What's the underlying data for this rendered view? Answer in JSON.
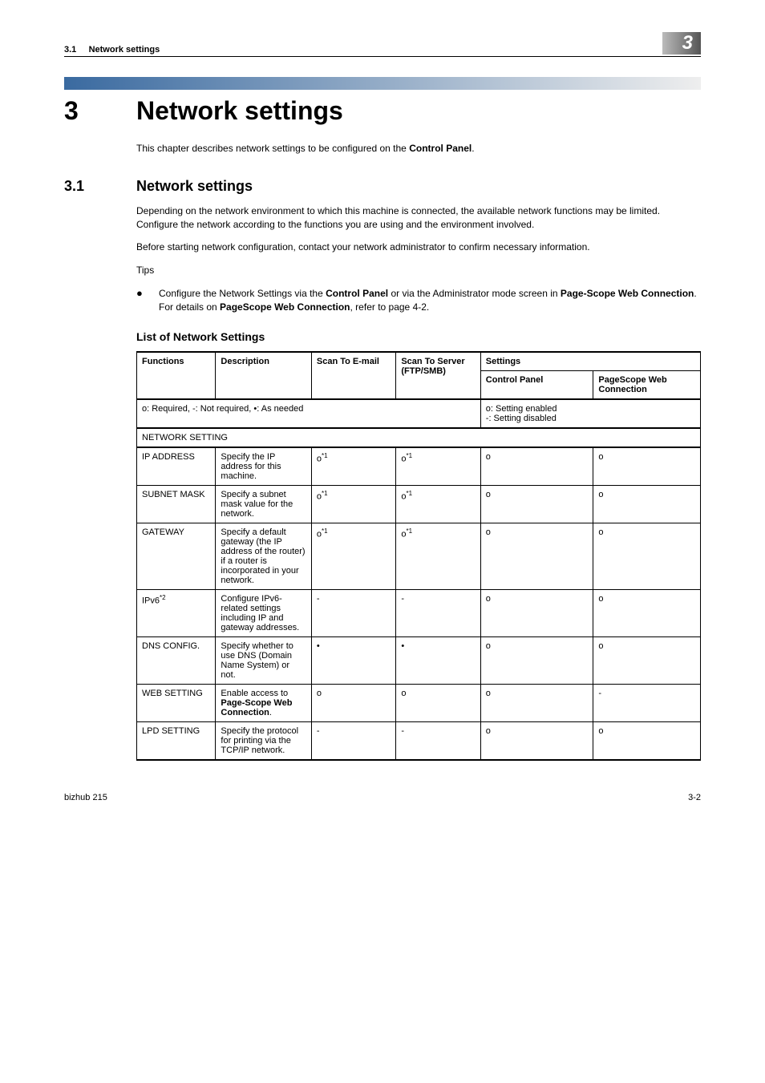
{
  "header": {
    "section_ref": "3.1",
    "section_text": "Network settings",
    "chapter_badge": "3"
  },
  "chapter": {
    "number": "3",
    "title": "Network settings",
    "intro": "This chapter describes network settings to be configured on the ",
    "intro_bold": "Control Panel",
    "intro_suffix": "."
  },
  "section": {
    "number": "3.1",
    "title": "Network settings",
    "p1": "Depending on the network environment to which this machine is connected, the available network functions may be limited. Configure the network according to the functions you are using and the environment involved.",
    "p2": "Before starting network configuration, contact your network administrator to confirm necessary information.",
    "tips_label": "Tips",
    "bullet_pre": "Configure the Network Settings via the ",
    "bullet_b1": "Control Panel",
    "bullet_mid1": " or via the Administrator mode screen in ",
    "bullet_b2": "Page-Scope Web Connection",
    "bullet_mid2": ". For details on ",
    "bullet_b3": "PageScope Web Connection",
    "bullet_suffix": ", refer to page 4-2."
  },
  "table": {
    "heading": "List of Network Settings",
    "cols": {
      "functions": "Functions",
      "description": "Description",
      "scan_email": "Scan To E-mail",
      "scan_server": "Scan To Server (FTP/SMB)",
      "settings": "Settings",
      "control_panel": "Control Panel",
      "pagescope": "PageScope Web Connection"
    },
    "legend_left": "o: Required, -: Not required, •: As needed",
    "legend_right": "o: Setting enabled\n-: Setting disabled",
    "group": "NETWORK SETTING",
    "rows": [
      {
        "fn": "IP ADDRESS",
        "desc": "Specify the IP address for this machine.",
        "email": "o*1",
        "server": "o*1",
        "cp": "o",
        "ps": "o"
      },
      {
        "fn": "SUBNET MASK",
        "desc": "Specify a subnet mask value for the network.",
        "email": "o*1",
        "server": "o*1",
        "cp": "o",
        "ps": "o"
      },
      {
        "fn": "GATEWAY",
        "desc": "Specify a default gateway (the IP address of the router) if a router is incorporated in your network.",
        "email": "o*1",
        "server": "o*1",
        "cp": "o",
        "ps": "o"
      },
      {
        "fn": "IPv6*2",
        "desc": "Configure IPv6-related settings including IP and gateway addresses.",
        "email": "-",
        "server": "-",
        "cp": "o",
        "ps": "o"
      },
      {
        "fn": "DNS CONFIG.",
        "desc": "Specify whether to use DNS (Domain Name System) or not.",
        "email": "•",
        "server": "•",
        "cp": "o",
        "ps": "o"
      },
      {
        "fn": "WEB SETTING",
        "desc_pre": "Enable access to ",
        "desc_bold": "Page-Scope Web Connection",
        "desc_suf": ".",
        "email": "o",
        "server": "o",
        "cp": "o",
        "ps": "-"
      },
      {
        "fn": "LPD SETTING",
        "desc": "Specify the protocol for printing via the TCP/IP network.",
        "email": "-",
        "server": "-",
        "cp": "o",
        "ps": "o"
      }
    ]
  },
  "footer": {
    "left": "bizhub 215",
    "right": "3-2"
  }
}
